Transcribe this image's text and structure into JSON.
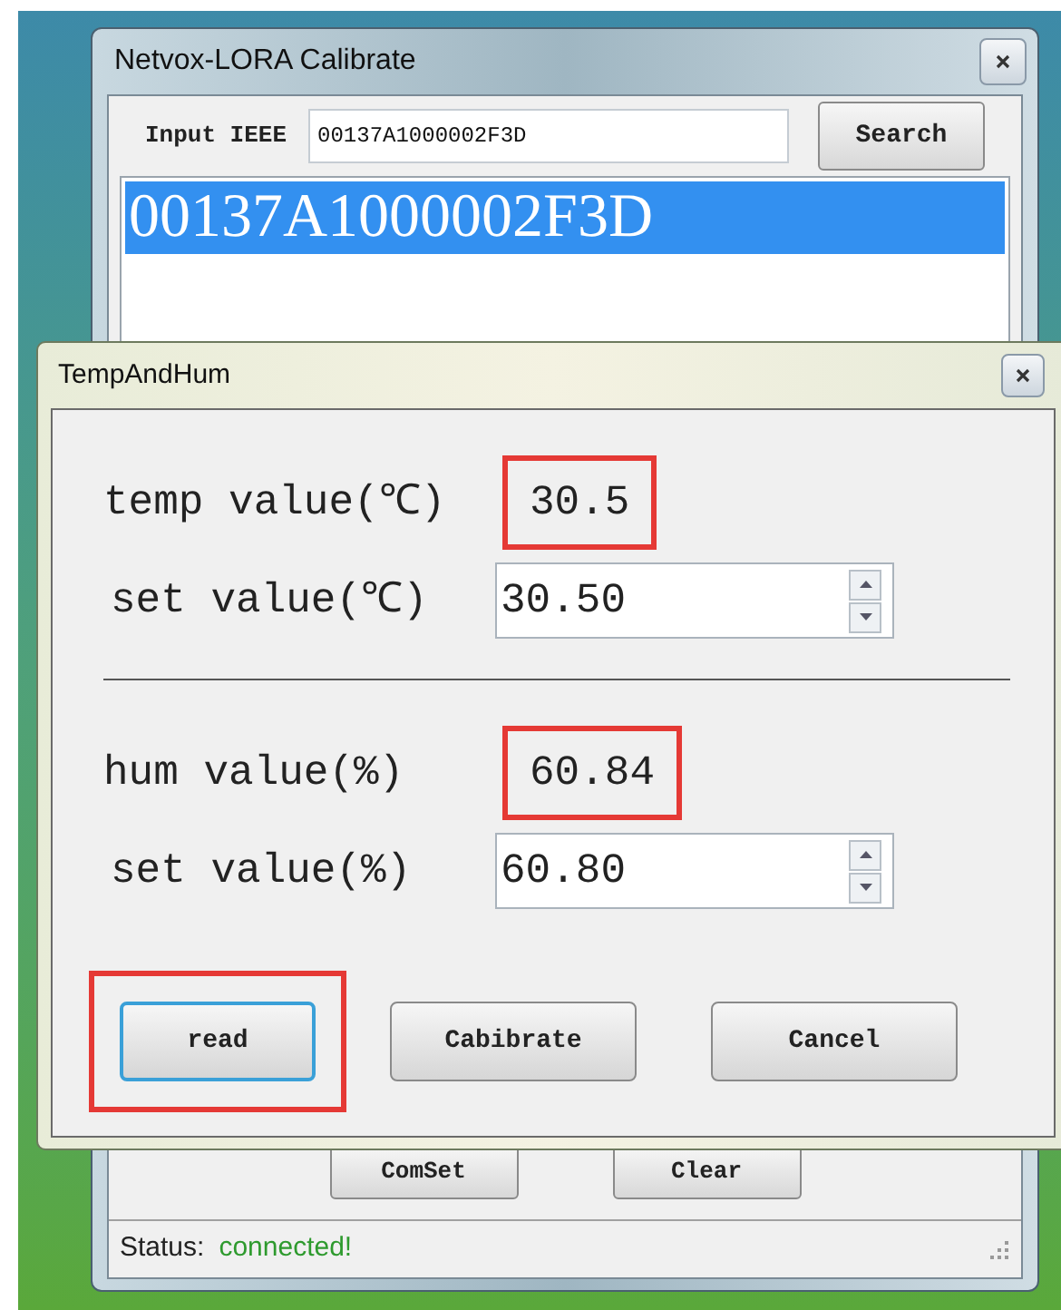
{
  "main_window": {
    "title": "Netvox-LORA Calibrate",
    "input": {
      "label": "Input IEEE",
      "value": "00137A1000002F3D"
    },
    "search_button": "Search",
    "device_list": [
      {
        "label": "00137A1000002F3D",
        "selected": true
      }
    ],
    "buttons": [
      "ComSet",
      "Clear"
    ],
    "status": {
      "label": "Status:",
      "value": "connected!"
    }
  },
  "dialog": {
    "title": "TempAndHum",
    "sections": [
      {
        "reading_label": "temp value(℃)",
        "reading": "30.5",
        "highlighted": true,
        "set_label": "set value(℃)",
        "set_value": "30.50"
      },
      {
        "reading_label": "hum value(%)",
        "reading": "60.84",
        "highlighted": true,
        "set_label": "set value(%)",
        "set_value": "60.80"
      }
    ],
    "buttons": [
      {
        "label": "read",
        "focused": true,
        "highlighted": true
      },
      {
        "label": "Cabibrate",
        "focused": false,
        "highlighted": false
      },
      {
        "label": "Cancel",
        "focused": false,
        "highlighted": false
      }
    ]
  }
}
